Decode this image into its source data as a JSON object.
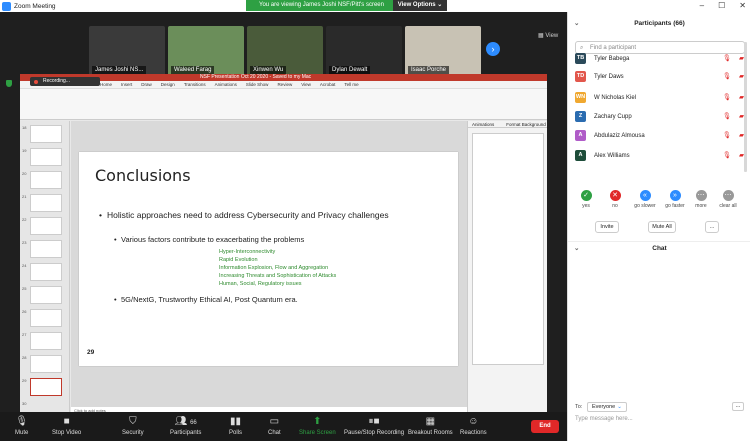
{
  "window": {
    "title": "Zoom Meeting",
    "controls": [
      "–",
      "☐",
      "✕"
    ]
  },
  "banner": {
    "text": "You are viewing James Joshi NSF/Pitt's screen",
    "view_options": "View Options ⌄"
  },
  "gallery": {
    "participants": [
      {
        "name": "James Joshi NS...",
        "bg": "#3a3a3a"
      },
      {
        "name": "Waleed Farag",
        "bg": "#6b8e5a"
      },
      {
        "name": "Xinwen Wu",
        "bg": "#4a5b3a"
      },
      {
        "name": "Dylan Dewalt",
        "bg": "#2a2a2a"
      },
      {
        "name": "Isaac Porche",
        "bg": "#c8c2b4"
      }
    ],
    "view_label": "View"
  },
  "powerpoint": {
    "recording_label": "Recording...",
    "doc_title": "NSF Presentation Oct 20 2020 - Saved to my Mac",
    "tabs": [
      "Home",
      "Insert",
      "Draw",
      "Design",
      "Transitions",
      "Animations",
      "Slide Show",
      "Review",
      "View",
      "Acrobat",
      "Tell me"
    ],
    "slide_numbers": [
      "18",
      "19",
      "20",
      "21",
      "22",
      "23",
      "24",
      "25",
      "26",
      "27",
      "28",
      "29",
      "30"
    ],
    "animations_tabs": [
      "Animations",
      "Format Background"
    ],
    "notes_placeholder": "Click to add notes",
    "status_text": "Slide 29 of 30   English (United States)",
    "slide": {
      "title": "Conclusions",
      "bullet1": "Holistic approaches need to address Cybersecurity and Privacy challenges",
      "bullet2": "Various factors contribute to exacerbating the problems",
      "green_items": [
        "Hyper-Interconnectivity",
        "Rapid Evolution",
        "Information Explosion, Flow and Aggregation",
        "Increasing Threats and Sophistication of Attacks",
        "Human, Social, Regulatory issues"
      ],
      "bullet3": "5G/NextG, Trustworthy Ethical AI, Post Quantum era.",
      "page_number": "29"
    }
  },
  "toolbar": {
    "mute": "Mute",
    "stop_video": "Stop Video",
    "security": "Security",
    "participants": "Participants",
    "participant_count": "66",
    "polls": "Polls",
    "chat": "Chat",
    "share_screen": "Share Screen",
    "recording": "Pause/Stop Recording",
    "breakout": "Breakout Rooms",
    "reactions": "Reactions",
    "end": "End"
  },
  "participants_panel": {
    "title": "Participants (66)",
    "search_placeholder": "Find a participant",
    "list": [
      {
        "initials": "TB",
        "name": "Tyler Babega",
        "color": "#2b4a5a"
      },
      {
        "initials": "TD",
        "name": "Tyler Daws",
        "color": "#e2574c"
      },
      {
        "initials": "WN",
        "name": "W Nicholas Kiel",
        "color": "#f0a830"
      },
      {
        "initials": "Z",
        "name": "Zachary Cupp",
        "color": "#2b6cb0"
      },
      {
        "initials": "A",
        "name": "Abdulaziz Almousa",
        "color": "#b05cc8"
      },
      {
        "initials": "A",
        "name": "Alex Williams",
        "color": "#1e4d3a"
      }
    ],
    "reactions": [
      {
        "label": "yes",
        "symbol": "✓",
        "color": "#2ea043"
      },
      {
        "label": "no",
        "symbol": "✕",
        "color": "#e02828"
      },
      {
        "label": "go slower",
        "symbol": "«",
        "color": "#2d8cff"
      },
      {
        "label": "go faster",
        "symbol": "»",
        "color": "#2d8cff"
      },
      {
        "label": "more",
        "symbol": "⋯",
        "color": "#999999"
      },
      {
        "label": "clear all",
        "symbol": "⋯",
        "color": "#999999"
      }
    ],
    "invite": "Invite",
    "mute_all": "Mute All",
    "more_btn": "..."
  },
  "chat_panel": {
    "title": "Chat",
    "to_label": "To:",
    "to_value": "Everyone",
    "more": "...",
    "input_placeholder": "Type message here..."
  }
}
